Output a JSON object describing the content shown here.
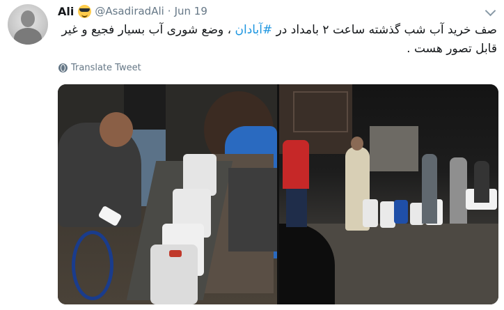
{
  "tweet": {
    "display_name": "Ali",
    "name_emoji": "smiling-face-with-sunglasses",
    "handle": "@AsadiradAli",
    "separator": "·",
    "date": "Jun 19",
    "text_before": "صف خرید آب شب گذشته ساعت ۲ بامداد در ",
    "hashtag": "#آبادان",
    "text_after": " ، وضع شوری آب بسیار فجیع و غیر قابل تصور هست .",
    "translate_label": "Translate Tweet",
    "colors": {
      "link": "#1b95e0",
      "secondary": "#657786",
      "text": "#14171a"
    }
  },
  "media": {
    "photos": [
      {
        "label": "water-queue-photo-1"
      },
      {
        "label": "water-queue-photo-2"
      }
    ]
  }
}
